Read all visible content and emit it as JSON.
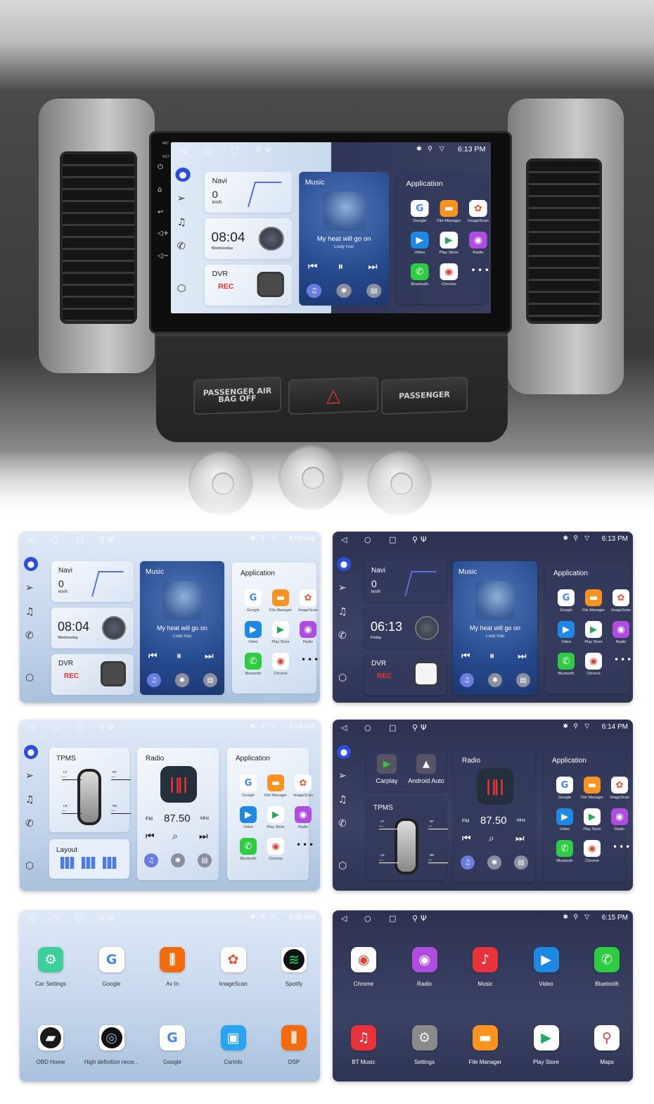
{
  "photo": {
    "bezel_labels": [
      "MIC",
      "RST"
    ],
    "airbag_label": "PASSENGER AIR BAG OFF",
    "passenger_label": "PASSENGER"
  },
  "screens": [
    {
      "kind": "home-music",
      "theme": "split",
      "status_time": "6:13 PM",
      "navi": {
        "title": "Navi",
        "speed": "0",
        "unit": "km/h"
      },
      "clock": {
        "time": "08:04",
        "day": "Wednesday"
      },
      "dvr": {
        "title": "DVR",
        "status": "REC"
      },
      "music": {
        "title": "Music",
        "song": "My heat will go on",
        "artist": "Cady Rao"
      },
      "apps": {
        "title": "Application",
        "items": [
          {
            "label": "Google",
            "icon": "google-icon",
            "color": "#ffffff"
          },
          {
            "label": "File Manager",
            "icon": "folder-icon",
            "color": "#f7931e"
          },
          {
            "label": "ImageScan",
            "icon": "photos-icon",
            "color": "#ffffff"
          },
          {
            "label": "Video",
            "icon": "video-icon",
            "color": "#1e88e5"
          },
          {
            "label": "Play Store",
            "icon": "play-store-icon",
            "color": "#ffffff"
          },
          {
            "label": "Radio",
            "icon": "podcast-icon",
            "color": "#b04ce0"
          },
          {
            "label": "Bluetooth",
            "icon": "phone-icon",
            "color": "#2ecc40"
          },
          {
            "label": "Chrome",
            "icon": "chrome-icon",
            "color": "#ffffff"
          }
        ]
      }
    },
    {
      "kind": "home-music",
      "theme": "light",
      "status_time": "8:04 AM",
      "navi": {
        "title": "Navi",
        "speed": "0",
        "unit": "km/h"
      },
      "clock": {
        "time": "08:04",
        "day": "Wednesday"
      },
      "dvr": {
        "title": "DVR",
        "status": "REC"
      },
      "music": {
        "title": "Music",
        "song": "My heat will go on",
        "artist": "Cady Rao"
      },
      "apps": {
        "title": "Application",
        "items": [
          {
            "label": "Google",
            "icon": "google-icon",
            "color": "#ffffff"
          },
          {
            "label": "File Manager",
            "icon": "folder-icon",
            "color": "#f7931e"
          },
          {
            "label": "ImageScan",
            "icon": "photos-icon",
            "color": "#ffffff"
          },
          {
            "label": "Video",
            "icon": "video-icon",
            "color": "#1e88e5"
          },
          {
            "label": "Play Store",
            "icon": "play-store-icon",
            "color": "#ffffff"
          },
          {
            "label": "Radio",
            "icon": "podcast-icon",
            "color": "#b04ce0"
          },
          {
            "label": "Bluetooth",
            "icon": "phone-icon",
            "color": "#2ecc40"
          },
          {
            "label": "Chrome",
            "icon": "chrome-icon",
            "color": "#ffffff"
          }
        ]
      }
    },
    {
      "kind": "home-music",
      "theme": "dark",
      "status_time": "6:13 PM",
      "navi": {
        "title": "Navi",
        "speed": "0",
        "unit": "km/h"
      },
      "clock": {
        "time": "06:13",
        "day": "Friday"
      },
      "dvr": {
        "title": "DVR",
        "status": "REC"
      },
      "music": {
        "title": "Music",
        "song": "My heat will go on",
        "artist": "Cady Rao"
      },
      "apps": {
        "title": "Application",
        "items": [
          {
            "label": "Google",
            "icon": "google-icon",
            "color": "#ffffff"
          },
          {
            "label": "File Manager",
            "icon": "folder-icon",
            "color": "#f7931e"
          },
          {
            "label": "ImageScan",
            "icon": "photos-icon",
            "color": "#ffffff"
          },
          {
            "label": "Video",
            "icon": "video-icon",
            "color": "#1e88e5"
          },
          {
            "label": "Play Store",
            "icon": "play-store-icon",
            "color": "#ffffff"
          },
          {
            "label": "Radio",
            "icon": "podcast-icon",
            "color": "#b04ce0"
          },
          {
            "label": "Bluetooth",
            "icon": "phone-icon",
            "color": "#2ecc40"
          },
          {
            "label": "Chrome",
            "icon": "chrome-icon",
            "color": "#ffffff"
          }
        ]
      }
    },
    {
      "kind": "home-radio",
      "theme": "light",
      "status_time": "8:04 AM",
      "tpms": {
        "title": "TPMS",
        "wheels": [
          {
            "pos": "LF",
            "value": "---"
          },
          {
            "pos": "RF",
            "value": "---"
          },
          {
            "pos": "LR",
            "value": "---"
          },
          {
            "pos": "RR",
            "value": "---"
          }
        ]
      },
      "layout": {
        "title": "Layout"
      },
      "radio": {
        "title": "Radio",
        "band": "FM",
        "freq": "87.50",
        "unit": "MHz"
      },
      "apps": {
        "title": "Application",
        "items": [
          {
            "label": "Google",
            "icon": "google-icon",
            "color": "#ffffff"
          },
          {
            "label": "File Manager",
            "icon": "folder-icon",
            "color": "#f7931e"
          },
          {
            "label": "ImageScan",
            "icon": "photos-icon",
            "color": "#ffffff"
          },
          {
            "label": "Video",
            "icon": "video-icon",
            "color": "#1e88e5"
          },
          {
            "label": "Play Store",
            "icon": "play-store-icon",
            "color": "#ffffff"
          },
          {
            "label": "Radio",
            "icon": "podcast-icon",
            "color": "#b04ce0"
          },
          {
            "label": "Bluetooth",
            "icon": "phone-icon",
            "color": "#2ecc40"
          },
          {
            "label": "Chrome",
            "icon": "chrome-icon",
            "color": "#ffffff"
          }
        ]
      }
    },
    {
      "kind": "home-radio",
      "theme": "dark",
      "status_time": "6:14 PM",
      "projection": {
        "carplay": "Carplay",
        "android_auto": "Android Auto"
      },
      "tpms": {
        "title": "TPMS",
        "wheels": [
          {
            "pos": "LF",
            "value": "—"
          },
          {
            "pos": "RF",
            "value": "—"
          },
          {
            "pos": "LR",
            "value": "—"
          },
          {
            "pos": "RR",
            "value": "—"
          }
        ]
      },
      "radio": {
        "title": "Radio",
        "band": "FM",
        "freq": "87.50",
        "unit": "MHz"
      },
      "apps": {
        "title": "Application",
        "items": [
          {
            "label": "Google",
            "icon": "google-icon",
            "color": "#ffffff"
          },
          {
            "label": "File Manager",
            "icon": "folder-icon",
            "color": "#f7931e"
          },
          {
            "label": "ImageScan",
            "icon": "photos-icon",
            "color": "#ffffff"
          },
          {
            "label": "Video",
            "icon": "video-icon",
            "color": "#1e88e5"
          },
          {
            "label": "Play Store",
            "icon": "play-store-icon",
            "color": "#ffffff"
          },
          {
            "label": "Radio",
            "icon": "podcast-icon",
            "color": "#b04ce0"
          },
          {
            "label": "Bluetooth",
            "icon": "phone-icon",
            "color": "#2ecc40"
          },
          {
            "label": "Chrome",
            "icon": "chrome-icon",
            "color": "#ffffff"
          }
        ]
      }
    },
    {
      "kind": "app-grid",
      "theme": "light",
      "status_time": "8:05 AM",
      "items": [
        {
          "label": "Car Settings",
          "icon": "car-settings-icon",
          "color": "#3ccf9a"
        },
        {
          "label": "Google",
          "icon": "google-icon",
          "color": "#ffffff"
        },
        {
          "label": "Av In",
          "icon": "av-in-icon",
          "color": "#f36b0c"
        },
        {
          "label": "ImageScan",
          "icon": "photos-icon",
          "color": "#ffffff"
        },
        {
          "label": "Spotify",
          "icon": "spotify-icon",
          "color": "#ffffff"
        },
        {
          "label": "OBD Home",
          "icon": "obd-icon",
          "color": "#ffffff"
        },
        {
          "label": "High definition recor...",
          "icon": "camera-icon",
          "color": "#ffffff"
        },
        {
          "label": "Google",
          "icon": "google-icon",
          "color": "#ffffff"
        },
        {
          "label": "CarInfo",
          "icon": "car-info-icon",
          "color": "#2aa3f0"
        },
        {
          "label": "DSP",
          "icon": "equalizer-icon",
          "color": "#f36b0c"
        }
      ]
    },
    {
      "kind": "app-grid",
      "theme": "dark",
      "status_time": "6:15 PM",
      "items": [
        {
          "label": "Chrome",
          "icon": "chrome-icon",
          "color": "#ffffff"
        },
        {
          "label": "Radio",
          "icon": "podcast-icon",
          "color": "#b04ce0"
        },
        {
          "label": "Music",
          "icon": "music-icon",
          "color": "#e8333c"
        },
        {
          "label": "Video",
          "icon": "video-icon",
          "color": "#1e88e5"
        },
        {
          "label": "Bluetooth",
          "icon": "phone-icon",
          "color": "#2ecc40"
        },
        {
          "label": "BT Music",
          "icon": "bt-music-icon",
          "color": "#e8333c"
        },
        {
          "label": "Settings",
          "icon": "settings-icon",
          "color": "#8a8a8a"
        },
        {
          "label": "File Manager",
          "icon": "folder-icon",
          "color": "#f7931e"
        },
        {
          "label": "Play Store",
          "icon": "play-store-icon",
          "color": "#ffffff"
        },
        {
          "label": "Maps",
          "icon": "maps-icon",
          "color": "#ffffff"
        }
      ]
    }
  ]
}
